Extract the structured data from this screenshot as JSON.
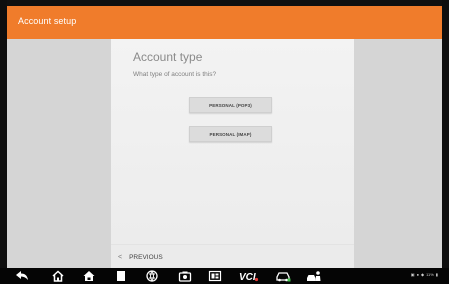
{
  "app_bar": {
    "title": "Account setup",
    "color": "#f07c2b"
  },
  "card": {
    "title": "Account type",
    "subtitle": "What type of account is this?",
    "options": [
      {
        "label": "PERSONAL (POP3)"
      },
      {
        "label": "PERSONAL (IMAP)"
      }
    ]
  },
  "footer": {
    "previous_label": "PREVIOUS"
  },
  "nav_bar": {
    "icons": [
      "back-icon",
      "home-icon",
      "house-icon",
      "recent-apps-icon",
      "browser-icon",
      "camera-icon",
      "gallery-icon",
      "vci-icon",
      "car-icon",
      "car-person-icon"
    ],
    "vci_label": "VCI",
    "status_text": "11%"
  }
}
